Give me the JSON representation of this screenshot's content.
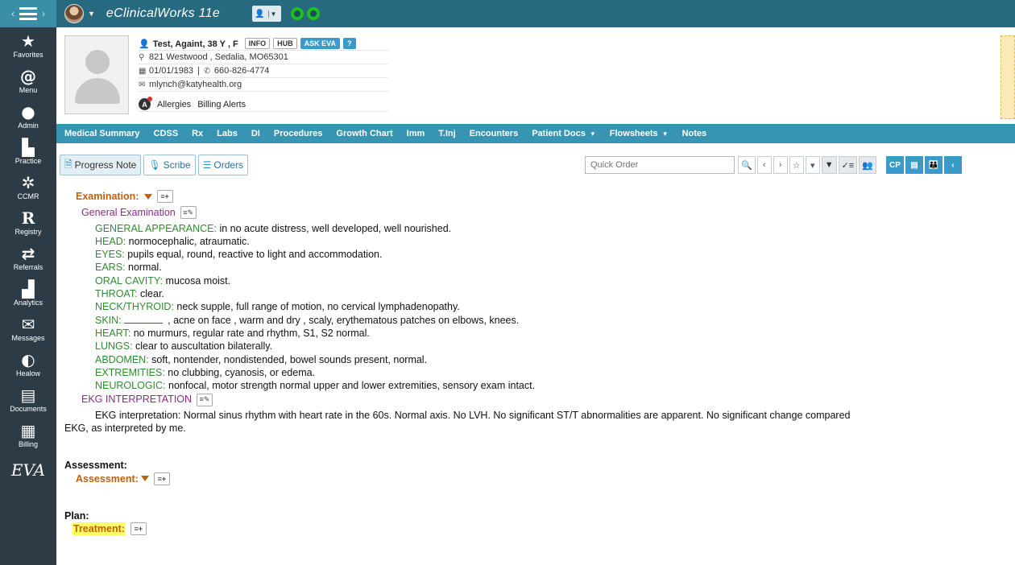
{
  "app": {
    "title": "eClinicalWorks 11e"
  },
  "sidebar": {
    "items": [
      {
        "label": "Favorites",
        "icon": "star-icon"
      },
      {
        "label": "Menu",
        "icon": "menu-swirl-icon"
      },
      {
        "label": "Admin",
        "icon": "admin-person-icon"
      },
      {
        "label": "Practice",
        "icon": "practice-building-icon"
      },
      {
        "label": "CCMR",
        "icon": "ccmr-icon"
      },
      {
        "label": "Registry",
        "icon": "registry-r-icon"
      },
      {
        "label": "Referrals",
        "icon": "referrals-arrows-icon"
      },
      {
        "label": "Analytics",
        "icon": "analytics-chart-icon"
      },
      {
        "label": "Messages",
        "icon": "envelope-icon"
      },
      {
        "label": "Healow",
        "icon": "healow-icon"
      },
      {
        "label": "Documents",
        "icon": "document-icon"
      },
      {
        "label": "Billing",
        "icon": "billing-icon"
      }
    ],
    "eva": "EVA"
  },
  "patient": {
    "name": "Test, Againt",
    "age_sex": ", 38 Y , F",
    "buttons": {
      "info": "INFO",
      "hub": "HUB",
      "ask_eva": "ASK EVA",
      "help": "?"
    },
    "address": "821 Westwood , Sedalia, MO65301",
    "dob": "01/01/1983",
    "phone": "660-826-4774",
    "email": "mlynch@katyhealth.org",
    "alerts": [
      "Allergies",
      "Billing Alerts"
    ]
  },
  "nav": {
    "tabs": [
      {
        "label": "Medical Summary",
        "dropdown": false
      },
      {
        "label": "CDSS",
        "dropdown": false
      },
      {
        "label": "Rx",
        "dropdown": false
      },
      {
        "label": "Labs",
        "dropdown": false
      },
      {
        "label": "DI",
        "dropdown": false
      },
      {
        "label": "Procedures",
        "dropdown": false
      },
      {
        "label": "Growth Chart",
        "dropdown": false
      },
      {
        "label": "Imm",
        "dropdown": false
      },
      {
        "label": "T.Inj",
        "dropdown": false
      },
      {
        "label": "Encounters",
        "dropdown": false
      },
      {
        "label": "Patient Docs",
        "dropdown": true
      },
      {
        "label": "Flowsheets",
        "dropdown": true
      },
      {
        "label": "Notes",
        "dropdown": false
      }
    ]
  },
  "subtabs": {
    "progress_note": "Progress Note",
    "scribe": "Scribe",
    "orders": "Orders"
  },
  "quick_order": {
    "placeholder": "Quick Order"
  },
  "toolbar": {
    "cp": "CP"
  },
  "note": {
    "examination_header": "Examination:",
    "general_exam_header": "General Examination",
    "exam_lines": [
      {
        "label": "GENERAL APPEARANCE:",
        "text": " in no acute distress, well developed, well nourished."
      },
      {
        "label": "HEAD:",
        "text": " normocephalic, atraumatic."
      },
      {
        "label": "EYES:",
        "text": " pupils equal, round, reactive to light and accommodation."
      },
      {
        "label": "EARS:",
        "text": " normal."
      },
      {
        "label": "ORAL CAVITY:",
        "text": " mucosa moist."
      },
      {
        "label": "THROAT:",
        "text": " clear."
      },
      {
        "label": "NECK/THYROID:",
        "text": " neck supple, full range of motion, no cervical lymphadenopathy."
      },
      {
        "label": "SKIN:",
        "text": " , acne on face , warm and dry , scaly, erythematous patches on elbows, knees."
      },
      {
        "label": "HEART:",
        "text": " no murmurs, regular rate and rhythm, S1, S2 normal."
      },
      {
        "label": "LUNGS:",
        "text": " clear to auscultation bilaterally."
      },
      {
        "label": "ABDOMEN:",
        "text": " soft, nontender, nondistended, bowel sounds present, normal."
      },
      {
        "label": "EXTREMITIES:",
        "text": " no clubbing, cyanosis, or edema."
      },
      {
        "label": "NEUROLOGIC:",
        "text": " nonfocal, motor strength normal upper and lower extremities, sensory exam intact."
      }
    ],
    "ekg_header": "EKG INTERPRETATION",
    "ekg_line1": "EKG interpretation: Normal sinus rhythm with heart rate in the 60s. Normal axis. No LVH. No significant ST/T abnormalities are apparent. No significant change compared",
    "ekg_line2": "EKG, as interpreted by me.",
    "assessment_section": "Assessment:",
    "assessment_sub": "Assessment:",
    "plan_section": "Plan:",
    "treatment_sub": "Treatment:"
  },
  "colors": {
    "topbar": "#27697e",
    "sidebar": "#2c3b45",
    "navbar": "#3794b3",
    "section_orange": "#c0600a",
    "exam_label_green": "#2f8b2f",
    "subsection_purple": "#8a2c8a",
    "highlight": "#ffff66",
    "status_green": "#1ec01e"
  }
}
